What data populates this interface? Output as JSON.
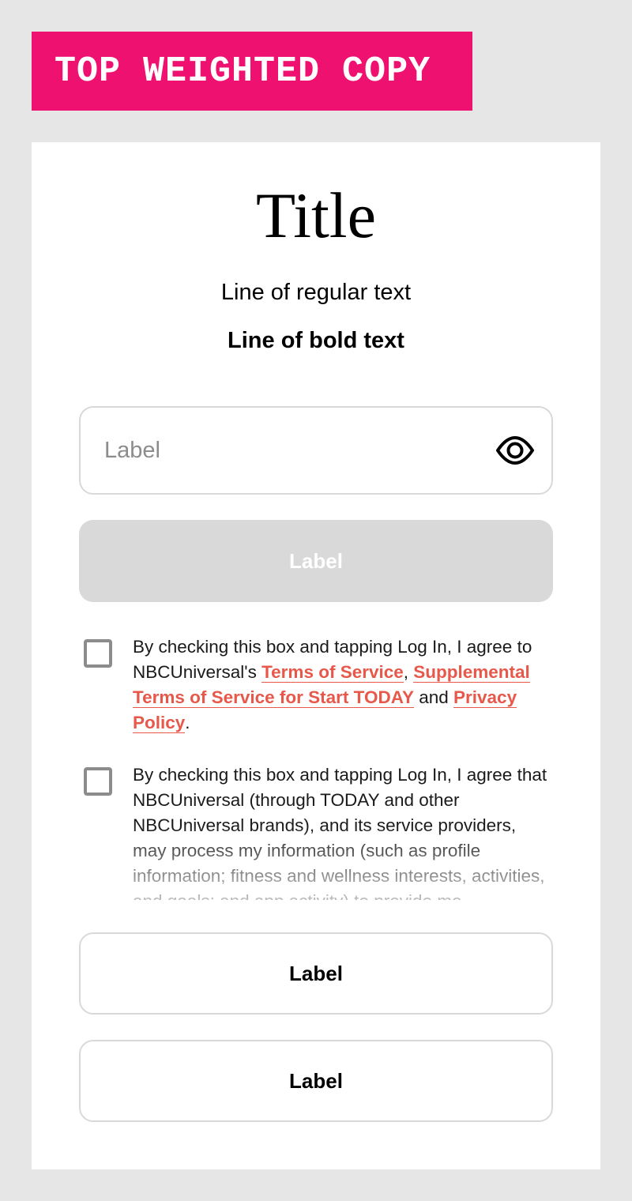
{
  "banner": {
    "text": "TOP WEIGHTED COPY"
  },
  "header": {
    "title": "Title",
    "regular_line": "Line of regular text",
    "bold_line": "Line of bold text"
  },
  "password_field": {
    "placeholder": "Label",
    "value": "",
    "toggle_icon": "eye-icon"
  },
  "primary_button": {
    "label": "Label",
    "state": "disabled"
  },
  "consent_1": {
    "checked": false,
    "text_1": "By checking this box and tapping Log In, I agree to NBCUniversal's ",
    "link_terms": "Terms of Service",
    "comma": ", ",
    "link_supplemental": "Supplemental Terms of Service for Start TODAY",
    "and": " and ",
    "link_privacy": "Privacy Policy",
    "period": "."
  },
  "consent_2": {
    "checked": false,
    "text": "By checking this box and tapping Log In, I agree that NBCUniversal (through TODAY and other NBCUniversal brands), and its service providers, may process my information (such as profile information; fitness and wellness interests, activities, and goals; and app activity) to provide me personalized"
  },
  "secondary_buttons": [
    {
      "label": "Label"
    },
    {
      "label": "Label"
    }
  ],
  "colors": {
    "banner_bg": "#ef1170",
    "link": "#e8584a",
    "disabled_bg": "#d9d9d9",
    "page_bg": "#e6e6e6"
  }
}
